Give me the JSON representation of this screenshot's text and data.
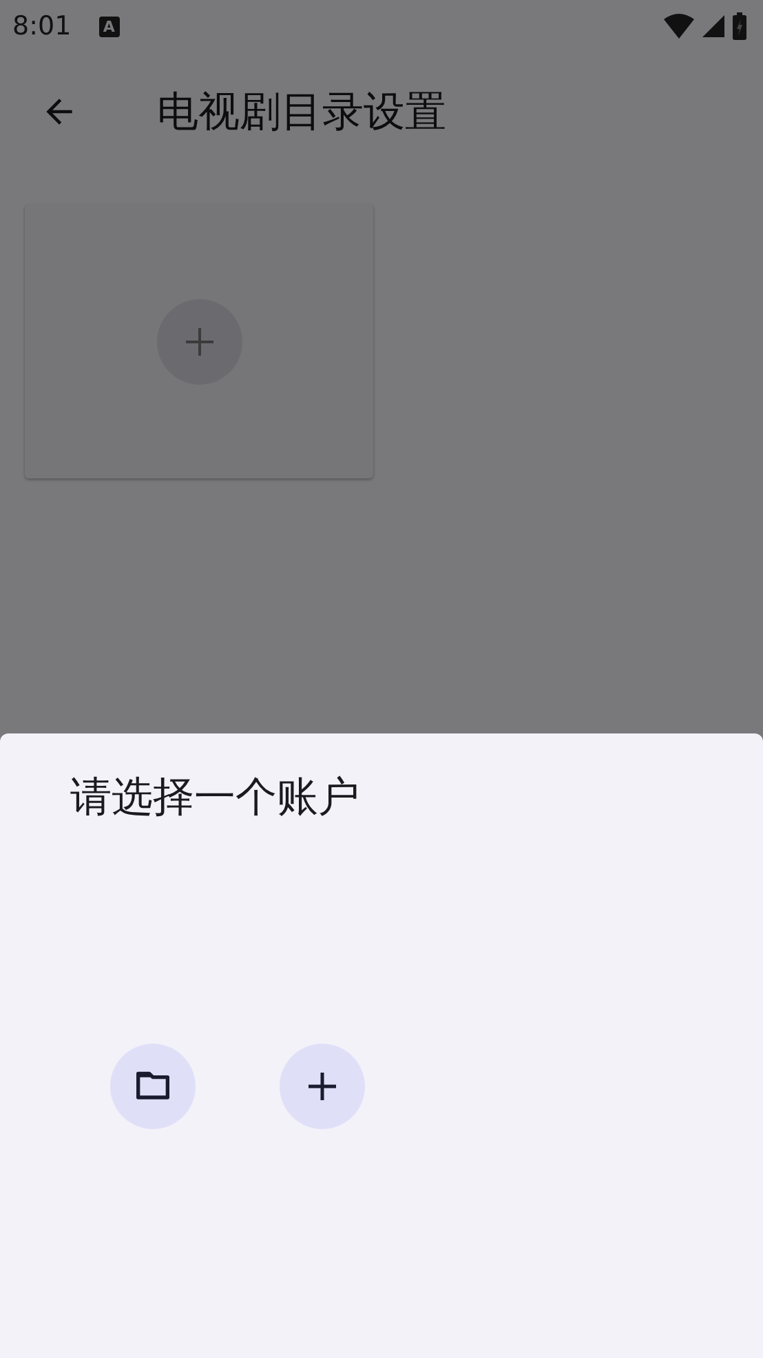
{
  "status_bar": {
    "time": "8:01",
    "notification": "A"
  },
  "top_bar": {
    "title": "电视剧目录设置"
  },
  "folders": [
    {
      "kind": "add"
    }
  ],
  "sheet": {
    "title": "请选择一个账户",
    "actions": [
      {
        "kind": "folder"
      },
      {
        "kind": "add"
      }
    ]
  }
}
